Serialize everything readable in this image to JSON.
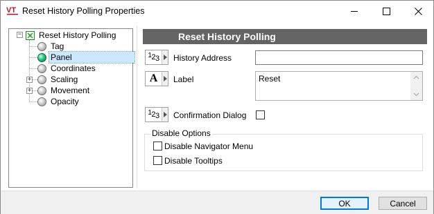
{
  "window": {
    "title": "Reset History Polling Properties",
    "app_icon": "vt-logo-icon",
    "controls": [
      "minimize-icon",
      "maximize-icon",
      "close-icon"
    ]
  },
  "tree": {
    "root": {
      "label": "Reset History Polling",
      "expander": "−",
      "icon": "root-object-icon"
    },
    "items": [
      {
        "label": "Tag",
        "icon": "gray-ball-icon",
        "expandable": false,
        "selected": false
      },
      {
        "label": "Panel",
        "icon": "green-ball-icon",
        "expandable": false,
        "selected": true
      },
      {
        "label": "Coordinates",
        "icon": "gray-ball-icon",
        "expandable": false,
        "selected": false
      },
      {
        "label": "Scaling",
        "icon": "gray-ball-icon",
        "expandable": true,
        "expander": "+",
        "selected": false
      },
      {
        "label": "Movement",
        "icon": "gray-ball-icon",
        "expandable": true,
        "expander": "+",
        "selected": false
      },
      {
        "label": "Opacity",
        "icon": "gray-ball-icon",
        "expandable": false,
        "selected": false
      }
    ]
  },
  "panel": {
    "header": "Reset History Polling",
    "fields": {
      "history_address": {
        "label": "History Address",
        "value": "",
        "type_icon": "numeric-123-icon"
      },
      "label": {
        "label": "Label",
        "value": "Reset",
        "type_icon": "text-A-icon"
      },
      "confirmation_dialog": {
        "label": "Confirmation Dialog",
        "checked": false,
        "type_icon": "numeric-123-icon"
      }
    },
    "disable_options": {
      "title": "Disable Options",
      "navigator_menu": {
        "label": "Disable Navigator Menu",
        "checked": false
      },
      "tooltips": {
        "label": "Disable Tooltips",
        "checked": false
      }
    }
  },
  "footer": {
    "ok_label": "OK",
    "cancel_label": "Cancel"
  },
  "colors": {
    "header_bg": "#646464",
    "selection_bg": "#cce8ff",
    "default_button_border": "#0078d7",
    "footer_bg": "#f0f0f0",
    "logo_red": "#c8102e"
  }
}
